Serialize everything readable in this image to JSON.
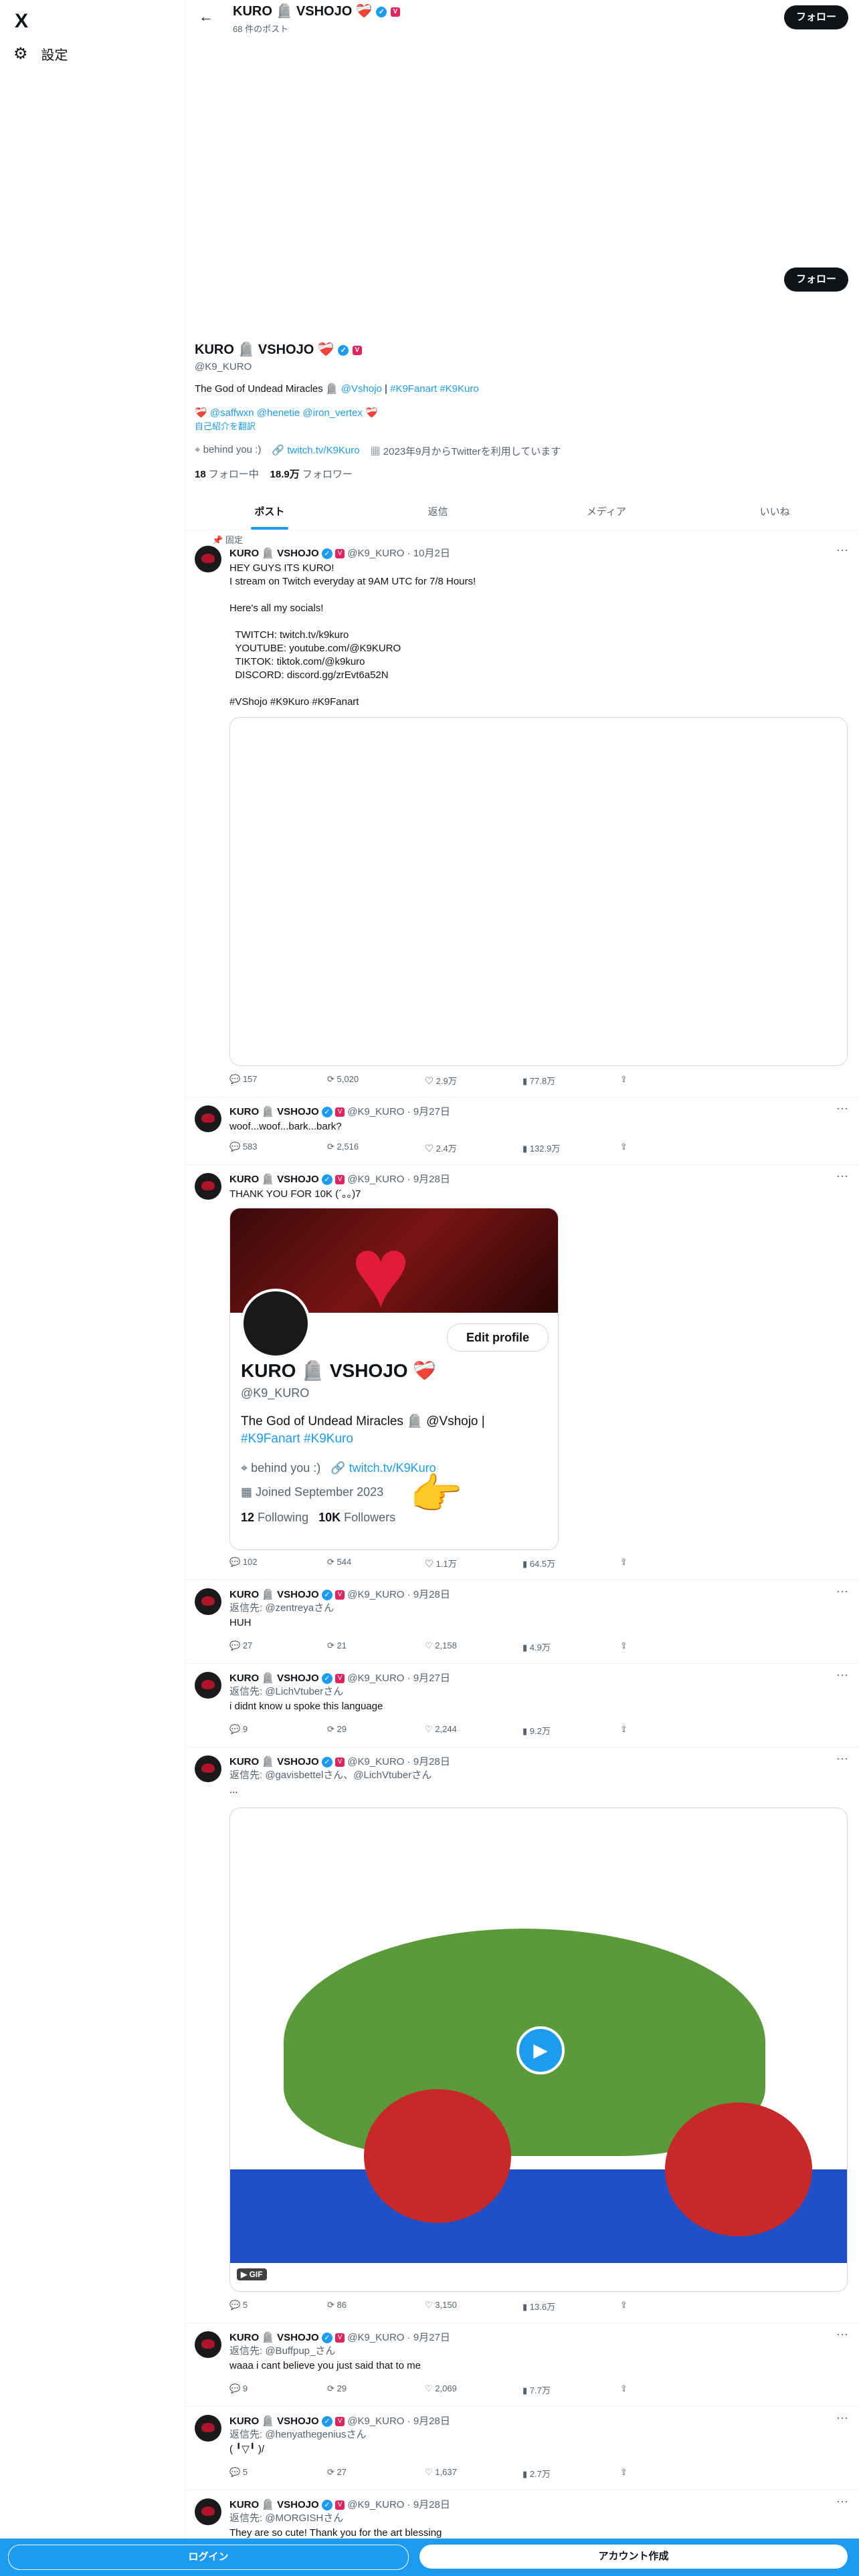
{
  "nav": {
    "logo": "X",
    "settings_label": "設定"
  },
  "header": {
    "name": "KURO 🪦 VSHOJO ❤️‍🩹",
    "post_count": "68 件のポスト",
    "follow_label": "フォロー"
  },
  "profile": {
    "name": "KURO 🪦 VSHOJO ❤️‍🩹",
    "handle": "@K9_KURO",
    "follow_label": "フォロー",
    "bio_text": "The God of Undead Miracles 🪦",
    "bio_mention": "@Vshojo",
    "bio_sep": " | ",
    "bio_tags": "#K9Fanart #K9Kuro",
    "bio_line2": "❤️‍🩹 @saffwxn @henetie @iron_vertex ❤️‍🩹",
    "translate": "自己紹介を翻訳",
    "location": "behind you :)",
    "website": "twitch.tv/K9Kuro",
    "joined": "2023年9月からTwitterを利用しています",
    "following_count": "18",
    "following_label": "フォロー中",
    "followers_count": "18.9万",
    "followers_label": "フォロワー"
  },
  "tabs": [
    "ポスト",
    "返信",
    "メディア",
    "いいね"
  ],
  "pinned_label": "固定",
  "tweets": [
    {
      "name": "KURO 🪦 VSHOJO",
      "handle": "@K9_KURO",
      "date": "10月2日",
      "reply_to": "",
      "text": "HEY GUYS ITS KURO!\nI stream on Twitch everyday at 9AM UTC for 7/8 Hours!\n\nHere's all my socials!\n\n  TWITCH: twitch.tv/k9kuro\n  YOUTUBE: youtube.com/@K9KURO\n  TIKTOK: tiktok.com/@k9kuro\n  DISCORD: discord.gg/zrEvt6a52N\n\n#VShojo #K9Kuro #K9Fanart",
      "replies": "157",
      "retweets": "5,020",
      "likes": "2.9万",
      "views": "77.8万"
    },
    {
      "name": "KURO 🪦 VSHOJO",
      "handle": "@K9_KURO",
      "date": "9月27日",
      "reply_to": "",
      "text": "woof...woof...bark...bark?",
      "replies": "583",
      "retweets": "2,516",
      "likes": "2.4万",
      "views": "132.9万"
    },
    {
      "name": "KURO 🪦 VSHOJO",
      "handle": "@K9_KURO",
      "date": "9月28日",
      "reply_to": "",
      "text": "THANK YOU FOR 10K (´｡｡)7",
      "card": {
        "name": "KURO 🪦 VSHOJO ❤️‍🩹",
        "handle": "@K9_KURO",
        "bio": "The God of Undead Miracles 🪦 @Vshojo |",
        "tags": "#K9Fanart #K9Kuro",
        "location": "behind you :)",
        "website": "twitch.tv/K9Kuro",
        "joined": "Joined September 2023",
        "following": "12",
        "following_label": "Following",
        "followers": "10K",
        "followers_label": "Followers",
        "edit": "Edit profile"
      },
      "replies": "102",
      "retweets": "544",
      "likes": "1.1万",
      "views": "64.5万"
    },
    {
      "name": "KURO 🪦 VSHOJO",
      "handle": "@K9_KURO",
      "date": "9月28日",
      "reply_to": "返信先: @zentreyaさん",
      "text": "HUH",
      "replies": "27",
      "retweets": "21",
      "likes": "2,158",
      "views": "4.9万"
    },
    {
      "name": "KURO 🪦 VSHOJO",
      "handle": "@K9_KURO",
      "date": "9月27日",
      "reply_to": "返信先: @LichVtuberさん",
      "text": "i didnt know u spoke this language",
      "replies": "9",
      "retweets": "29",
      "likes": "2,244",
      "views": "9.2万"
    },
    {
      "name": "KURO 🪦 VSHOJO",
      "handle": "@K9_KURO",
      "date": "9月28日",
      "reply_to": "返信先: @gavisbettelさん、@LichVtuberさん",
      "text": "...",
      "gif_label": "GIF",
      "replies": "5",
      "retweets": "86",
      "likes": "3,150",
      "views": "13.6万"
    },
    {
      "name": "KURO 🪦 VSHOJO",
      "handle": "@K9_KURO",
      "date": "9月27日",
      "reply_to": "返信先: @Buffpup_さん",
      "text": "waaa i cant believe you just said that to me",
      "replies": "9",
      "retweets": "29",
      "likes": "2,069",
      "views": "7.7万"
    },
    {
      "name": "KURO 🪦 VSHOJO",
      "handle": "@K9_KURO",
      "date": "9月28日",
      "reply_to": "返信先: @henyathegeniusさん",
      "text": "( ╹▽╹ )/",
      "replies": "5",
      "retweets": "27",
      "likes": "1,637",
      "views": "2.7万"
    },
    {
      "name": "KURO 🪦 VSHOJO",
      "handle": "@K9_KURO",
      "date": "9月28日",
      "reply_to": "返信先: @MORGISHさん",
      "text": "They are so cute! Thank you for the art blessing",
      "replies": "",
      "retweets": "",
      "likes": "",
      "views": ""
    }
  ],
  "bottom_bar": {
    "login": "ログイン",
    "signup": "アカウント作成"
  },
  "colors": {
    "accent": "#1d9bf0",
    "text": "#0f1419",
    "muted": "#536471"
  }
}
